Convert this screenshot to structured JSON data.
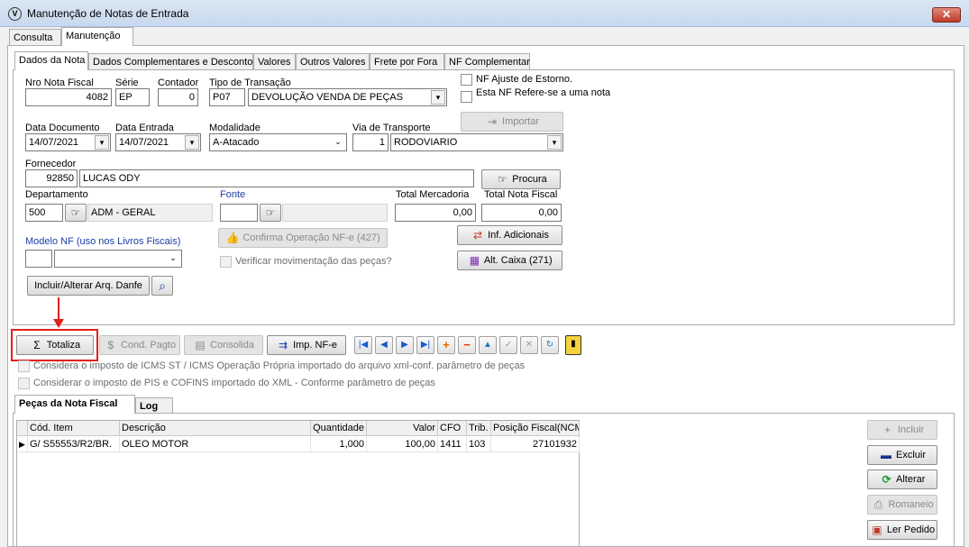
{
  "window": {
    "title": "Manutenção de Notas de Entrada",
    "close_label": "✕"
  },
  "main_tabs": [
    "Consulta",
    "Manutenção"
  ],
  "sub_tabs": [
    "Dados da Nota",
    "Dados Complementares e Desconto",
    "Valores",
    "Outros Valores",
    "Frete por Fora",
    "NF Complementar"
  ],
  "form": {
    "nro_label": "Nro Nota Fiscal",
    "nro_value": "4082",
    "serie_label": "Série",
    "serie_value": "EP",
    "contador_label": "Contador",
    "contador_value": "0",
    "tipo_label": "Tipo de Transação",
    "tipo_code": "P07",
    "tipo_value": "DEVOLUÇÃO VENDA DE PEÇAS",
    "chk_estorno": "NF Ajuste  de Estorno.",
    "chk_refere": "Esta NF Refere-se a uma nota",
    "importar_label": "Importar",
    "data_doc_label": "Data Documento",
    "data_doc_value": "14/07/2021",
    "data_entrada_label": "Data Entrada",
    "data_entrada_value": "14/07/2021",
    "modalidade_label": "Modalidade",
    "modalidade_value": "A-Atacado",
    "via_label": "Via de Transporte",
    "via_code": "1",
    "via_value": "RODOVIARIO",
    "fornecedor_label": "Fornecedor",
    "fornecedor_code": "92850",
    "fornecedor_name": "LUCAS ODY",
    "procura_label": "Procura",
    "departamento_label": "Departamento",
    "departamento_code": "500",
    "departamento_name": "ADM - GERAL",
    "fonte_label": "Fonte",
    "total_merc_label": "Total Mercadoria",
    "total_merc_value": "0,00",
    "total_nf_label": "Total Nota Fiscal",
    "total_nf_value": "0,00",
    "confirma_label": "Confirma Operação NF-e (427)",
    "inf_adicionais_label": "Inf. Adicionais",
    "modelo_label": "Modelo NF (uso nos Livros Fiscais)",
    "verificar_label": "Verificar movimentação das peças?",
    "alt_caixa_label": "Alt. Caixa (271)",
    "incluir_danfe_label": "Incluir/Alterar Arq. Danfe"
  },
  "toolbar": {
    "totaliza": "Totaliza",
    "cond_pagto": "Cond. Pagto",
    "consolida": "Consolida",
    "imp_nfe": "Imp. NF-e"
  },
  "options": {
    "icms": "Considera o imposto de ICMS ST / ICMS Operação Própria importado do arquivo xml-conf. parâmetro de peças",
    "pis": "Considerar o imposto de PIS e COFINS importado do XML - Conforme parâmetro de peças"
  },
  "bottom_tabs": [
    "Peças da Nota Fiscal",
    "Log"
  ],
  "grid": {
    "headers": [
      "Cód. Item",
      "Descrição",
      "Quantidade",
      "Valor",
      "CFO",
      "Trib.",
      "Posição Fiscal(NCM)"
    ],
    "rows": [
      [
        "G/  S55553/R2/BR.",
        "OLEO MOTOR",
        "1,000",
        "100,00",
        "1411",
        "103",
        "27101932"
      ]
    ]
  },
  "side_buttons": {
    "incluir": "Incluir",
    "excluir": "Excluir",
    "alterar": "Alterar",
    "romaneio": "Romaneio",
    "ler_pedido": "Ler Pedido"
  },
  "colors": {
    "highlight": "#e0201b",
    "label_blue": "#1a3ea8"
  }
}
